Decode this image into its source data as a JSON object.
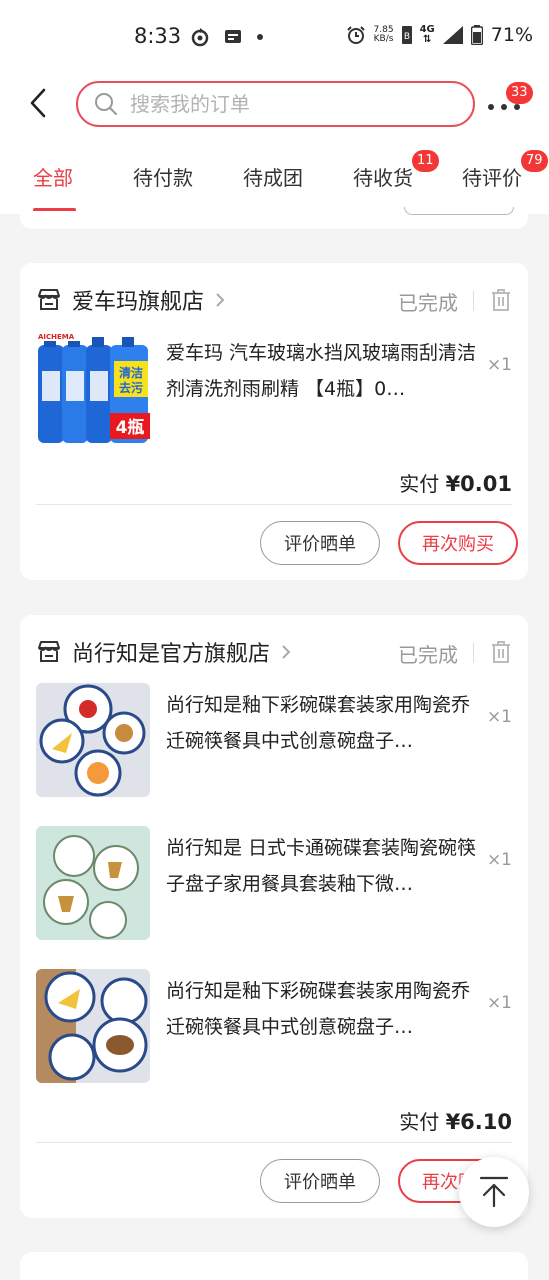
{
  "status_bar": {
    "time": "8:33",
    "net_speed_value": "7.85",
    "net_speed_unit": "KB/s",
    "network": "4G",
    "battery": "71%"
  },
  "header": {
    "search_placeholder": "搜索我的订单",
    "more_badge": "33"
  },
  "tabs": [
    {
      "label": "全部",
      "active": true
    },
    {
      "label": "待付款"
    },
    {
      "label": "待成团"
    },
    {
      "label": "待收货",
      "badge": "11"
    },
    {
      "label": "待评价",
      "badge": "79"
    }
  ],
  "orders": [
    {
      "shop": "爱车玛旗舰店",
      "status": "已完成",
      "items": [
        {
          "title": "爱车玛 汽车玻璃水挡风玻璃雨刮清洁剂清洗剂雨刷精 【4瓶】0…",
          "qty": "×1"
        }
      ],
      "paid_label": "实付",
      "paid_amount": "¥0.01",
      "btn_review": "评价晒单",
      "btn_rebuy": "再次购买"
    },
    {
      "shop": "尚行知是官方旗舰店",
      "status": "已完成",
      "items": [
        {
          "title": "尚行知是釉下彩碗碟套装家用陶瓷乔迁碗筷餐具中式创意碗盘子…",
          "qty": "×1"
        },
        {
          "title": "尚行知是 日式卡通碗碟套装陶瓷碗筷子盘子家用餐具套装釉下微…",
          "qty": "×1"
        },
        {
          "title": "尚行知是釉下彩碗碟套装家用陶瓷乔迁碗筷餐具中式创意碗盘子…",
          "qty": "×1"
        }
      ],
      "paid_label": "实付",
      "paid_amount": "¥6.10",
      "btn_review": "评价晒单",
      "btn_rebuy": "再次购买"
    }
  ],
  "thumb_text": {
    "brand": "AICHEMA",
    "badge_clean": "清洁去污",
    "badge_count": "4瓶"
  },
  "colors": {
    "accent": "#ea3d45",
    "badge": "#f33636",
    "muted": "#999999"
  }
}
